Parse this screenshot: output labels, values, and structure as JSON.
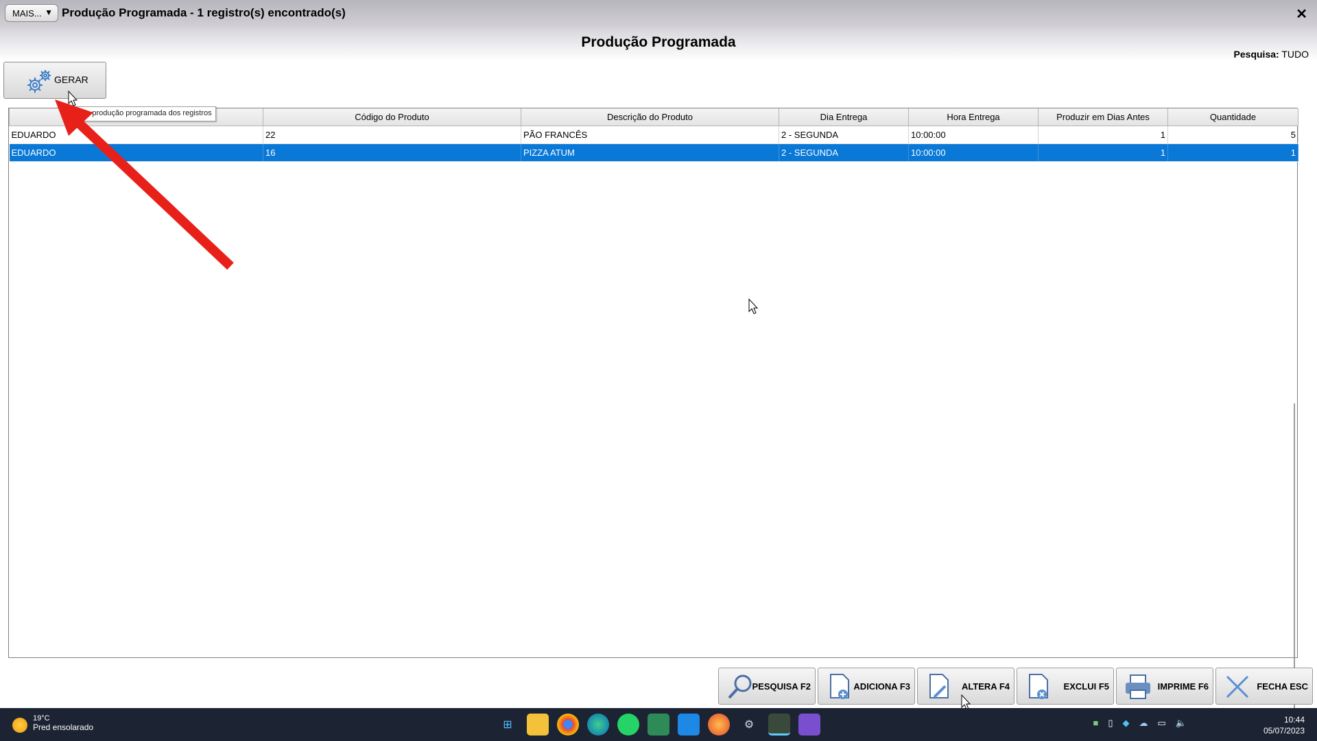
{
  "titlebar": {
    "mais_label": "MAIS...",
    "mais_arrow": "▼",
    "title": "Produção Programada - 1 registro(s) encontrado(s)",
    "close": "✕"
  },
  "header": {
    "page_title": "Produção Programada",
    "search_label": "Pesquisa:",
    "search_value": "TUDO"
  },
  "gerar": {
    "label": "GERAR",
    "tooltip": "a a produção programada dos registros"
  },
  "table": {
    "columns": [
      "",
      "Código do Produto",
      "Descrição do Produto",
      "Dia Entrega",
      "Hora Entrega",
      "Produzir em Dias Antes",
      "Quantidade"
    ],
    "rows": [
      [
        "EDUARDO",
        "22",
        "PÃO FRANCÊS",
        "2 - SEGUNDA",
        "10:00:00",
        "1",
        "5"
      ],
      [
        "EDUARDO",
        "16",
        "PIZZA ATUM",
        "2 - SEGUNDA",
        "10:00:00",
        "1",
        "1"
      ]
    ],
    "selected_row": 1
  },
  "toolbar": {
    "buttons": [
      {
        "label": "PESQUISA F2",
        "icon": "search-icon"
      },
      {
        "label": "ADICIONA F3",
        "icon": "add-document-icon"
      },
      {
        "label": "ALTERA F4",
        "icon": "edit-document-icon"
      },
      {
        "label": "EXCLUI F5",
        "icon": "delete-document-icon"
      },
      {
        "label": "IMPRIME F6",
        "icon": "printer-icon"
      },
      {
        "label": "FECHA ESC",
        "icon": "close-icon"
      }
    ]
  },
  "taskbar": {
    "weather_temp": "19°C",
    "weather_desc": "Pred ensolarado",
    "time": "10:44",
    "date": "05/07/2023"
  },
  "colors": {
    "selection": "#0a78d7",
    "arrow": "#e8201a",
    "taskbar": "#1c2433"
  }
}
